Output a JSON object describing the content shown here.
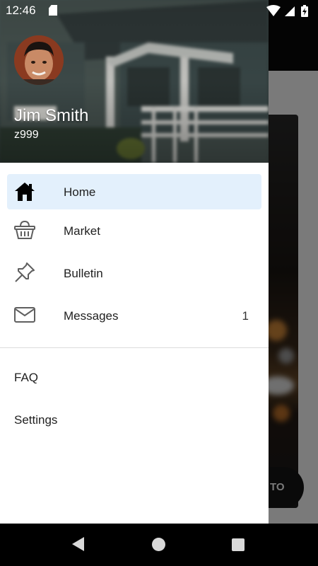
{
  "status_bar": {
    "time": "12:46"
  },
  "background": {
    "fab_label": "TO"
  },
  "drawer": {
    "user": {
      "name": "Jim Smith",
      "id": "z999"
    },
    "primary_items": [
      {
        "label": "Home",
        "icon": "home-icon",
        "active": true
      },
      {
        "label": "Market",
        "icon": "basket-icon",
        "active": false
      },
      {
        "label": "Bulletin",
        "icon": "pushpin-icon",
        "active": false
      },
      {
        "label": "Messages",
        "icon": "mail-icon",
        "active": false,
        "count": "1"
      }
    ],
    "secondary_items": [
      {
        "label": "FAQ"
      },
      {
        "label": "Settings"
      }
    ]
  },
  "colors": {
    "active_item_bg": "#e3f0fc",
    "drawer_bg": "#ffffff",
    "text": "#1f1f1f",
    "scrim": "#000000"
  }
}
